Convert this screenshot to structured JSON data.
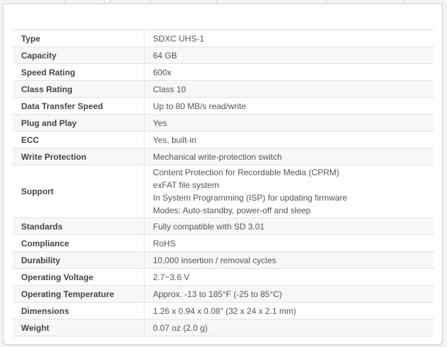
{
  "specs": [
    {
      "label": "Type",
      "lines": [
        "SDXC UHS-1"
      ]
    },
    {
      "label": "Capacity",
      "lines": [
        "64 GB"
      ]
    },
    {
      "label": "Speed Rating",
      "lines": [
        "600x"
      ]
    },
    {
      "label": "Class Rating",
      "lines": [
        "Class 10"
      ]
    },
    {
      "label": "Data Transfer Speed",
      "lines": [
        "Up to 80 MB/s read/write"
      ]
    },
    {
      "label": "Plug and Play",
      "lines": [
        "Yes"
      ]
    },
    {
      "label": "ECC",
      "lines": [
        "Yes, built-in"
      ]
    },
    {
      "label": "Write Protection",
      "lines": [
        "Mechanical write-protection switch"
      ]
    },
    {
      "label": "Support",
      "lines": [
        "Content Protection for Recordable Media (CPRM)",
        "exFAT file system",
        "In System Programming (ISP) for updating firmware",
        "Modes: Auto-standby, power-off and sleep"
      ]
    },
    {
      "label": "Standards",
      "lines": [
        "Fully compatible with SD 3.01"
      ]
    },
    {
      "label": "Compliance",
      "lines": [
        "RoHS"
      ]
    },
    {
      "label": "Durability",
      "lines": [
        "10,000 insertion / removal cycles"
      ]
    },
    {
      "label": "Operating Voltage",
      "lines": [
        "2.7~3.6 V"
      ]
    },
    {
      "label": "Operating Temperature",
      "lines": [
        "Approx. -13 to 185°F (-25 to 85°C)"
      ]
    },
    {
      "label": "Dimensions",
      "lines": [
        "1.26 x 0.94 x 0.08\" (32 x 24 x 2.1 mm)"
      ]
    },
    {
      "label": "Weight",
      "lines": [
        "0.07 oz (2.0 g)"
      ]
    }
  ]
}
